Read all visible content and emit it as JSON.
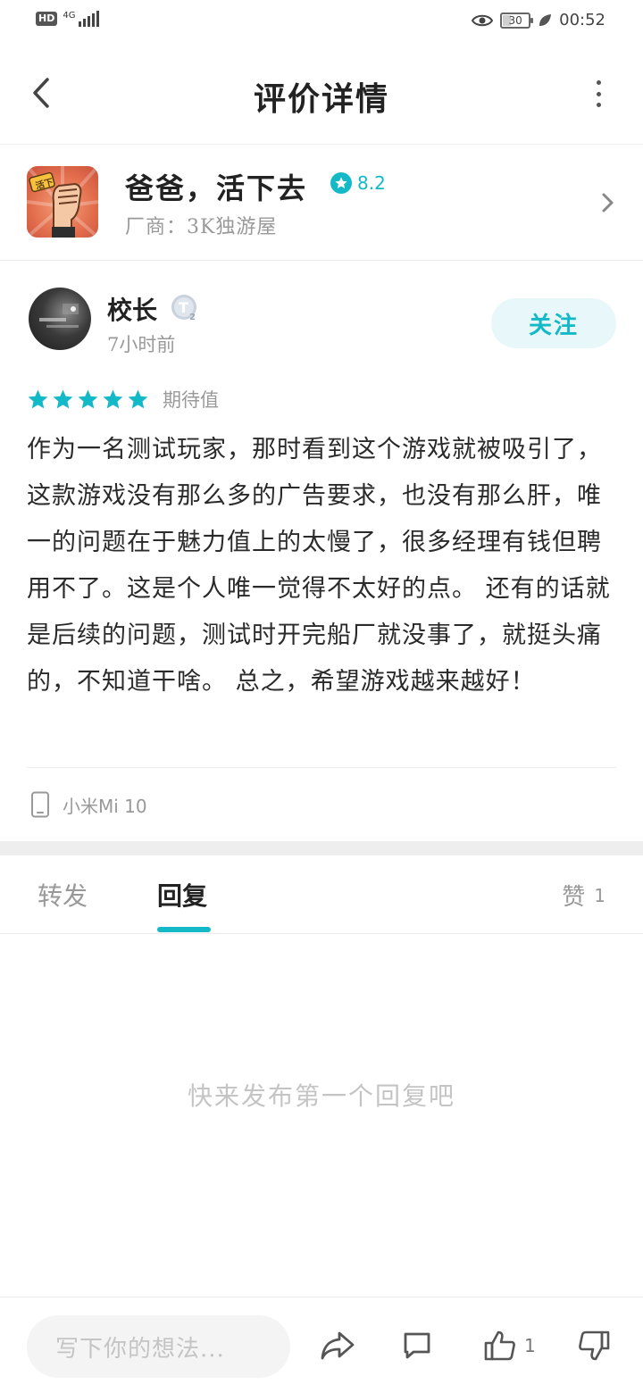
{
  "status_bar": {
    "hd": "HD",
    "network": "4G",
    "battery": "30",
    "time": "00:52"
  },
  "header": {
    "title": "评价详情"
  },
  "game": {
    "name": "爸爸，活下去",
    "rating": "8.2",
    "vendor": "厂商：3K独游屋",
    "icon_text": "活下"
  },
  "review": {
    "user_name": "校长",
    "level_badge": "T2",
    "time_ago": "7小时前",
    "follow_label": "关注",
    "stars": 5,
    "star_label": "期待值",
    "body": "作为一名测试玩家，那时看到这个游戏就被吸引了，这款游戏没有那么多的广告要求，也没有那么肝，唯一的问题在于魅力值上的太慢了，很多经理有钱但聘用不了。这是个人唯一觉得不太好的点。 还有的话就是后续的问题，测试时开完船厂就没事了，就挺头痛的，不知道干啥。 总之，希望游戏越来越好！",
    "device": "小米Mi 10"
  },
  "tabs": {
    "forward": "转发",
    "reply": "回复",
    "like_label": "赞",
    "like_count": "1"
  },
  "empty_hint": "快来发布第一个回复吧",
  "bottom_bar": {
    "input_placeholder": "写下你的想法...",
    "like_count": "1"
  },
  "colors": {
    "accent": "#14b9c8",
    "muted_text": "#999999"
  }
}
